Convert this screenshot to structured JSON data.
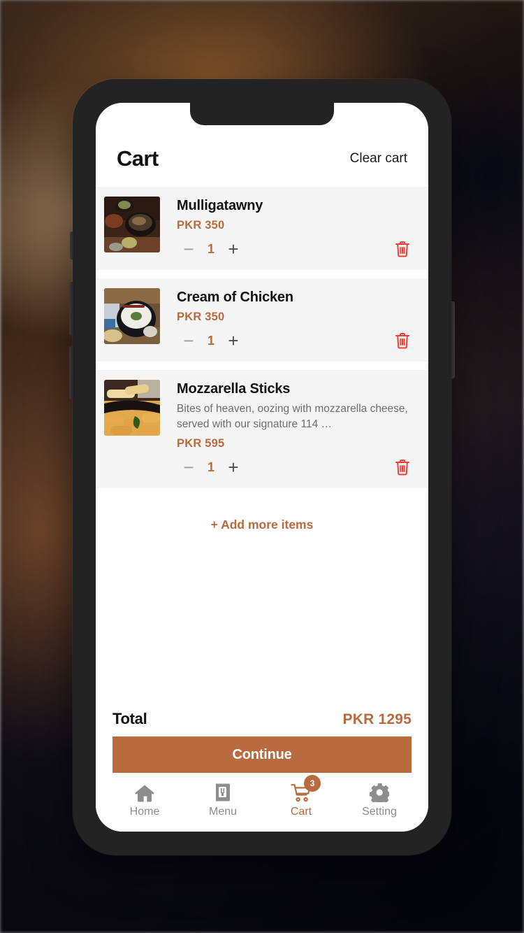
{
  "header": {
    "title": "Cart",
    "clear_label": "Clear cart"
  },
  "currency": "PKR",
  "accent_color": "#b96a3e",
  "danger_color": "#ef4136",
  "card_bg": "#f5f5f5",
  "items": [
    {
      "name": "Mulligatawny",
      "description": "",
      "price": "PKR 350",
      "qty": "1",
      "minus": "−",
      "plus": "+",
      "image_alt": "mulligatawny-soup-bowl"
    },
    {
      "name": "Cream of Chicken",
      "description": "",
      "price": "PKR 350",
      "qty": "1",
      "minus": "−",
      "plus": "+",
      "image_alt": "cream-of-chicken-pot"
    },
    {
      "name": "Mozzarella Sticks",
      "description": "Bites of heaven, oozing with mozzarella cheese, served with our signature 114 …",
      "price": "PKR 595",
      "qty": "1",
      "minus": "−",
      "plus": "+",
      "image_alt": "mozzarella-sticks-plate"
    }
  ],
  "add_more_label": "+ Add more items",
  "summary": {
    "total_label": "Total",
    "total_value": "PKR 1295",
    "continue_label": "Continue"
  },
  "bottom_nav": [
    {
      "label": "Home",
      "icon": "home-icon",
      "active": false,
      "badge": ""
    },
    {
      "label": "Menu",
      "icon": "menu-icon",
      "active": false,
      "badge": ""
    },
    {
      "label": "Cart",
      "icon": "cart-icon",
      "active": true,
      "badge": "3"
    },
    {
      "label": "Setting",
      "icon": "gear-icon",
      "active": false,
      "badge": ""
    }
  ]
}
